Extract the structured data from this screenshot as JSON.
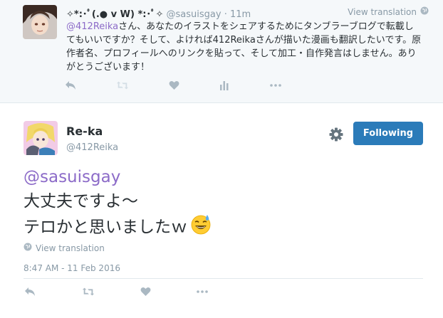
{
  "parent_tweet": {
    "name": "✧*:･ﾟ(.● v W) *:･ﾟ✧",
    "handle": "@sasuisgay",
    "separator": "·",
    "time": "11m",
    "view_translation": "View translation",
    "mention": "@412Reika",
    "text": "さん、あなたのイラストをシェアするためにタンブラーブログで転載してもいいですか？そして、よければ412Reikaさんが描いた漫画も翻訳したいです。原作者名、プロフィールへのリンクを貼って、そして加工・自作発言はしません。ありがとうございます！"
  },
  "main_tweet": {
    "name": "Re-ka",
    "handle": "@412Reika",
    "follow_label": "Following",
    "mention": "@sasuisgay",
    "line1": "大丈夫ですよ～",
    "line2": "テロかと思いましたｗ",
    "view_translation": "View translation",
    "date": "8:47 AM - 11 Feb 2016"
  },
  "colors": {
    "accent": "#2b7bb9",
    "mention": "#8c6bc8",
    "muted": "#8899a6",
    "parent_bg": "#f5f8fa"
  },
  "icons": [
    "reply-icon",
    "retweet-icon",
    "like-icon",
    "analytics-icon",
    "more-icon",
    "globe-icon",
    "gear-icon",
    "sweat-smile-emoji"
  ]
}
